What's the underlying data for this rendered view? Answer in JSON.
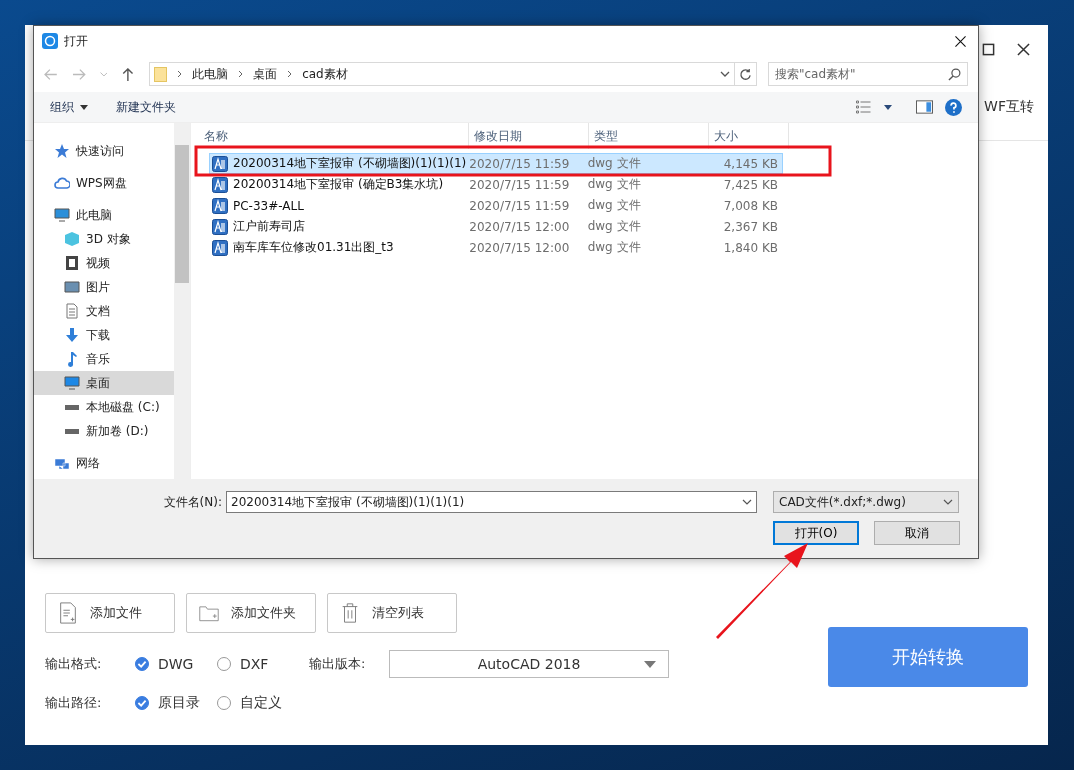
{
  "app": {
    "tab_partial": "WF互转",
    "actions": [
      {
        "kind": "file",
        "label": "添加文件"
      },
      {
        "kind": "folder",
        "label": "添加文件夹"
      },
      {
        "kind": "trash",
        "label": "清空列表"
      }
    ],
    "format_label": "输出格式:",
    "formats": [
      {
        "label": "DWG",
        "selected": true
      },
      {
        "label": "DXF",
        "selected": false
      }
    ],
    "version_label": "输出版本:",
    "version": "AutoCAD 2018",
    "path_label": "输出路径:",
    "paths": [
      {
        "label": "原目录",
        "selected": true
      },
      {
        "label": "自定义",
        "selected": false
      }
    ],
    "start_button": "开始转换"
  },
  "dialog": {
    "title": "打开",
    "breadcrumb": [
      "此电脑",
      "桌面",
      "cad素材"
    ],
    "search": {
      "placeholder": "搜索\"cad素材\""
    },
    "toolbar": [
      {
        "label": "组织",
        "dropdown": true
      },
      {
        "label": "新建文件夹",
        "dropdown": false
      }
    ],
    "sidebar": [
      {
        "kind": "star",
        "label": "快速访问",
        "selected": false
      },
      {
        "kind": "cloud",
        "label": "WPS网盘",
        "selected": false
      },
      {
        "kind": "pc",
        "label": "此电脑",
        "selected": false,
        "children": [
          {
            "kind": "cube",
            "label": "3D 对象",
            "selected": false
          },
          {
            "kind": "video",
            "label": "视频",
            "selected": false
          },
          {
            "kind": "image",
            "label": "图片",
            "selected": false
          },
          {
            "kind": "doc",
            "label": "文档",
            "selected": false
          },
          {
            "kind": "download",
            "label": "下载",
            "selected": false
          },
          {
            "kind": "music",
            "label": "音乐",
            "selected": false
          },
          {
            "kind": "desktop",
            "label": "桌面",
            "selected": true
          },
          {
            "kind": "drive-c",
            "label": "本地磁盘 (C:)",
            "selected": false
          },
          {
            "kind": "drive",
            "label": "新加卷 (D:)",
            "selected": false
          }
        ]
      },
      {
        "kind": "network",
        "label": "网络",
        "selected": false
      }
    ],
    "columns": [
      "名称",
      "修改日期",
      "类型",
      "大小"
    ],
    "files": [
      {
        "name": "20200314地下室报审 (不砌墙图)(1)(1)(1)",
        "date": "2020/7/15 11:59",
        "type": "dwg 文件",
        "size": "4,145 KB",
        "selected": true
      },
      {
        "name": "20200314地下室报审 (确定B3集水坑)",
        "date": "2020/7/15 11:59",
        "type": "dwg 文件",
        "size": "7,425 KB",
        "selected": false
      },
      {
        "name": "PC-33#-ALL",
        "date": "2020/7/15 11:59",
        "type": "dwg 文件",
        "size": "7,008 KB",
        "selected": false
      },
      {
        "name": "江户前寿司店",
        "date": "2020/7/15 12:00",
        "type": "dwg 文件",
        "size": "2,367 KB",
        "selected": false
      },
      {
        "name": "南车库车位修改01.31出图_t3",
        "date": "2020/7/15 12:00",
        "type": "dwg 文件",
        "size": "1,840 KB",
        "selected": false
      }
    ],
    "filename_label": "文件名(N):",
    "filename": "20200314地下室报审 (不砌墙图)(1)(1)(1)",
    "filter": "CAD文件(*.dxf;*.dwg)",
    "buttons": [
      {
        "label": "打开(O)",
        "selected": true
      },
      {
        "label": "取消",
        "selected": false
      }
    ]
  }
}
